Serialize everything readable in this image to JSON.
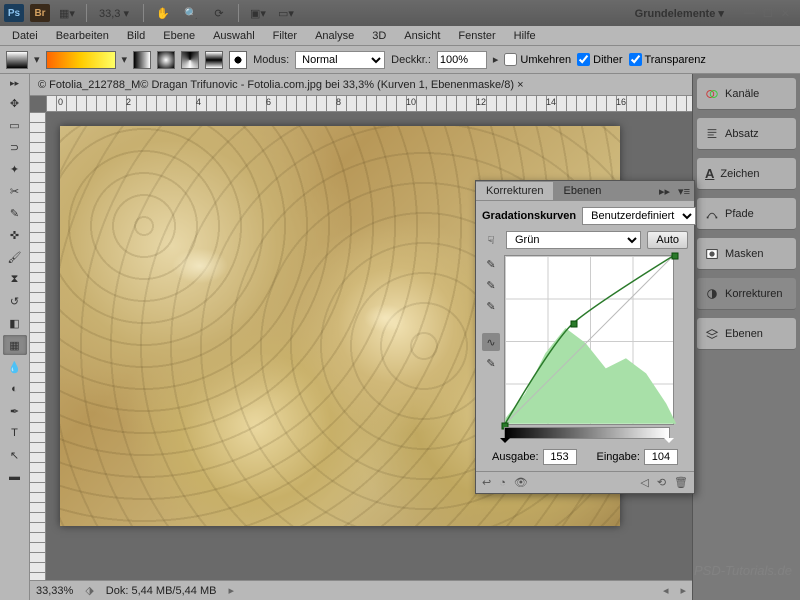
{
  "titlebar": {
    "zoom": "33,3",
    "workspace": "Grundelemente ▾"
  },
  "menu": [
    "Datei",
    "Bearbeiten",
    "Bild",
    "Ebene",
    "Auswahl",
    "Filter",
    "Analyse",
    "3D",
    "Ansicht",
    "Fenster",
    "Hilfe"
  ],
  "optbar": {
    "mode_label": "Modus:",
    "mode_value": "Normal",
    "opacity_label": "Deckkr.:",
    "opacity_value": "100%",
    "reverse": "Umkehren",
    "dither": "Dither",
    "transp": "Transparenz"
  },
  "doc": {
    "tab": "© Fotolia_212788_M© Dragan Trifunovic - Fotolia.com.jpg bei 33,3% (Kurven 1, Ebenenmaske/8) ×",
    "ruler_marks": [
      "0",
      "2",
      "4",
      "6",
      "8",
      "10",
      "12",
      "14",
      "16"
    ]
  },
  "status": {
    "zoom": "33,33%",
    "docsize": "Dok: 5,44 MB/5,44 MB"
  },
  "panels": [
    "Kanäle",
    "Absatz",
    "Zeichen",
    "Pfade",
    "Masken",
    "Korrekturen",
    "Ebenen"
  ],
  "adj": {
    "tab1": "Korrekturen",
    "tab2": "Ebenen",
    "title": "Gradationskurven",
    "preset": "Benutzerdefiniert",
    "channel": "Grün",
    "auto": "Auto",
    "output_label": "Ausgabe:",
    "output_value": "153",
    "input_label": "Eingabe:",
    "input_value": "104"
  },
  "chart_data": {
    "type": "line",
    "title": "Gradationskurven (Grün)",
    "xlabel": "Eingabe",
    "ylabel": "Ausgabe",
    "xlim": [
      0,
      255
    ],
    "ylim": [
      0,
      255
    ],
    "series": [
      {
        "name": "curve",
        "x": [
          0,
          104,
          255
        ],
        "y": [
          0,
          153,
          255
        ]
      },
      {
        "name": "baseline",
        "x": [
          0,
          255
        ],
        "y": [
          0,
          255
        ]
      }
    ],
    "histogram": {
      "x": [
        0,
        32,
        64,
        96,
        128,
        160,
        192,
        224,
        255
      ],
      "values": [
        5,
        30,
        70,
        95,
        80,
        55,
        65,
        50,
        20
      ]
    },
    "selected_point": {
      "input": 104,
      "output": 153
    }
  },
  "watermark": "PSD-Tutorials.de"
}
